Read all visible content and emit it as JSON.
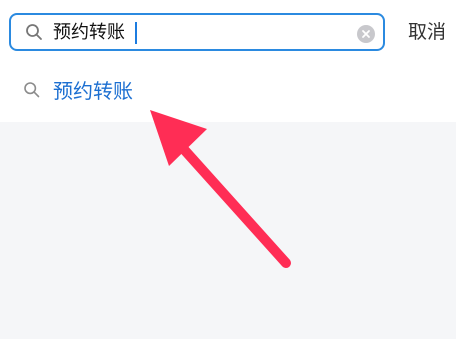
{
  "search": {
    "query": "预约转账",
    "cancel_label": "取消"
  },
  "suggestions": [
    {
      "label": "预约转账"
    }
  ],
  "icons": {
    "search": "search-icon",
    "clear": "clear-icon",
    "suggestion": "search-icon",
    "annotation": "arrow-annotation"
  },
  "colors": {
    "accent": "#2b8ae0",
    "suggestion_text": "#1c6fd1",
    "arrow": "#ff2d55",
    "background": "#f5f6f8",
    "panel": "#ffffff"
  }
}
